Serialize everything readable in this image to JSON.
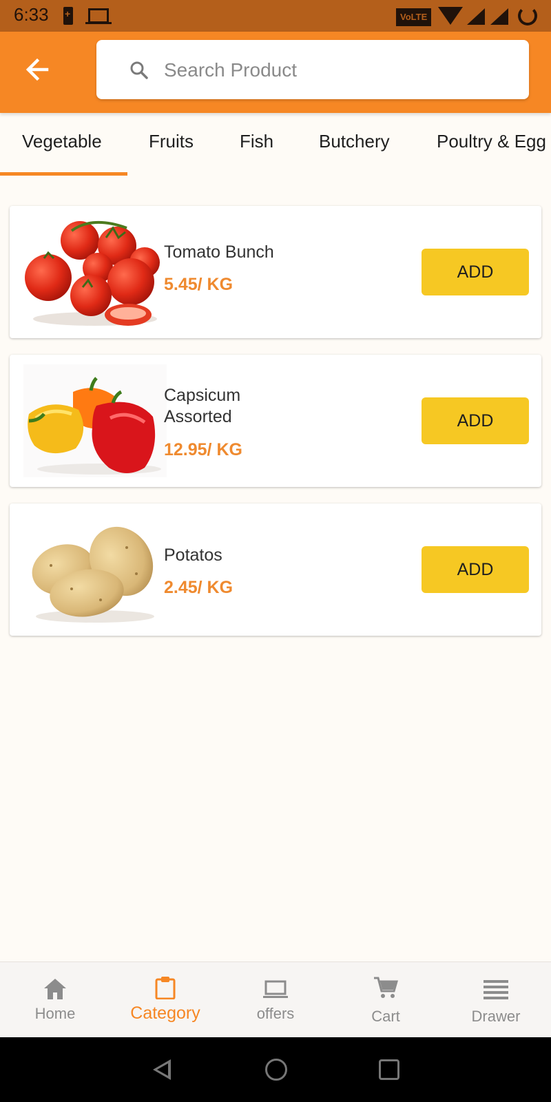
{
  "status_bar": {
    "time": "6:33",
    "volte_label": "VoLTE"
  },
  "header": {
    "search_placeholder": "Search Product"
  },
  "tabs": [
    {
      "label": "Vegetable",
      "active": true
    },
    {
      "label": "Fruits",
      "active": false
    },
    {
      "label": "Fish",
      "active": false
    },
    {
      "label": "Butchery",
      "active": false
    },
    {
      "label": "Poultry & Egg",
      "active": false
    }
  ],
  "products": [
    {
      "name": "Tomato Bunch",
      "price": "5.45/ KG",
      "button": "ADD",
      "image": "tomato-image"
    },
    {
      "name": "Capsicum Assorted",
      "price": "12.95/ KG",
      "button": "ADD",
      "image": "capsicum-image"
    },
    {
      "name": "Potatos",
      "price": "2.45/ KG",
      "button": "ADD",
      "image": "potato-image"
    }
  ],
  "bottom_nav": [
    {
      "label": "Home",
      "icon": "home-icon",
      "active": false
    },
    {
      "label": "Category",
      "icon": "clipboard-icon",
      "active": true
    },
    {
      "label": "offers",
      "icon": "laptop-icon",
      "active": false
    },
    {
      "label": "Cart",
      "icon": "cart-icon",
      "active": false
    },
    {
      "label": "Drawer",
      "icon": "menu-icon",
      "active": false
    }
  ],
  "colors": {
    "primary": "#f68724",
    "status_bar": "#b45f1b",
    "add_button": "#f6c823",
    "price": "#ef8a2f",
    "background": "#fefbf6"
  }
}
